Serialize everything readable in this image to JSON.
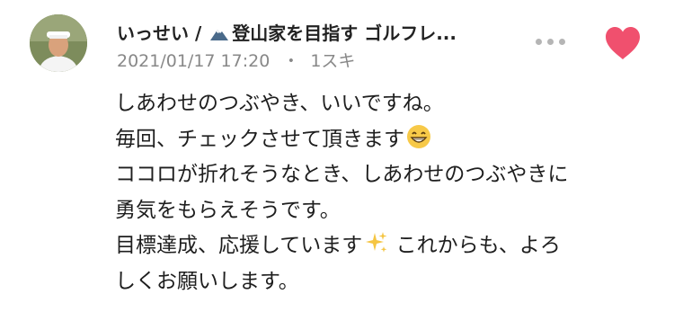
{
  "comment": {
    "author_name": "いっせい / ",
    "author_tagline": "登山家を目指す ゴルフレ...",
    "mountain_icon": "mountain-icon",
    "timestamp": "2021/01/17 17:20",
    "separator": "・",
    "likes": "1スキ",
    "more_icon": "more-dots-icon",
    "like_icon": "heart-icon",
    "like_color": "#f0506e",
    "lines": [
      "しあわせのつぶやき、いいですね。",
      "毎回、チェックさせて頂きます",
      "ココロが折れそうなとき、しあわせのつぶやきに",
      "勇気をもらえそうです。",
      "目標達成、応援しています",
      " これからも、よろ",
      "しくお願いします。"
    ],
    "emoji_1": "grinning-face-emoji",
    "emoji_2": "sparkles-emoji"
  }
}
